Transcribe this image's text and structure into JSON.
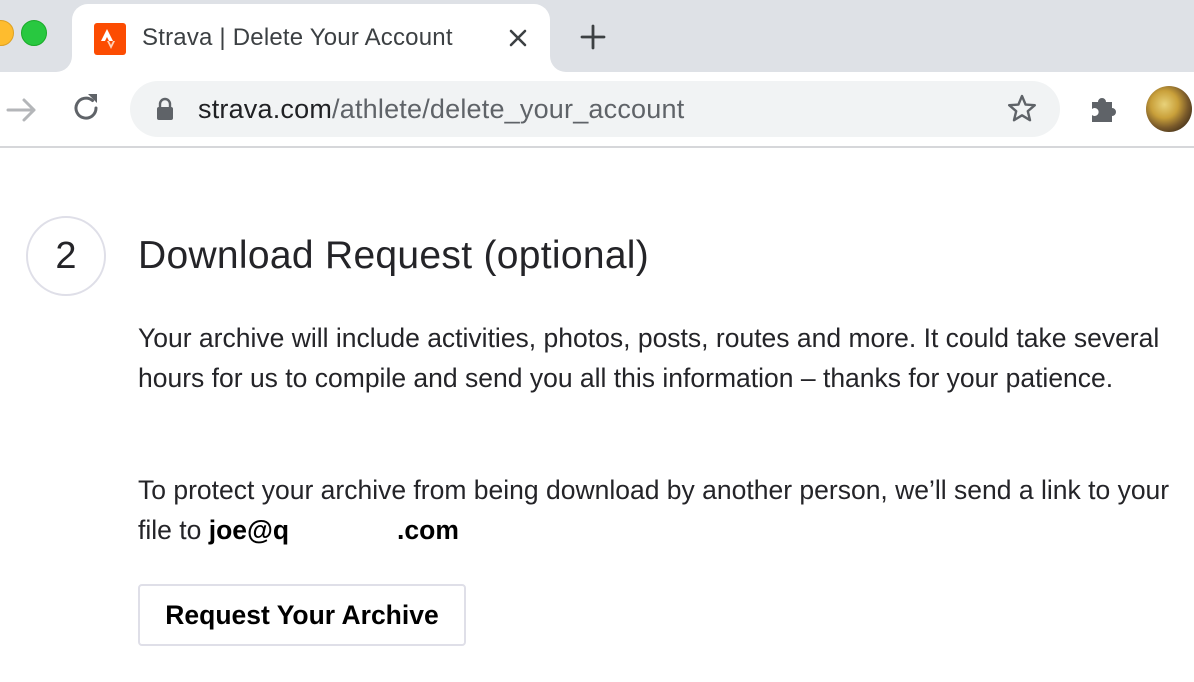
{
  "browser": {
    "tab": {
      "title": "Strava | Delete Your Account",
      "favicon": "strava-logo-icon",
      "favicon_color": "#fc4c02"
    },
    "new_tab_icon": "plus-icon",
    "toolbar": {
      "forward_icon": "arrow-right-icon",
      "reload_icon": "reload-icon",
      "url_host": "strava.com",
      "url_path": "/athlete/delete_your_account",
      "lock_icon": "lock-icon",
      "bookmark_icon": "star-icon",
      "extensions_icon": "puzzle-icon"
    }
  },
  "page": {
    "step_number": "2",
    "title": "Download Request (optional)",
    "paragraph1": "Your archive will include activities, photos, posts, routes and more. It could take several hours for us to compile and send you all this information – thanks for your patience.",
    "paragraph2_prefix": "To protect your archive from being download by another person, we’ll send a link to your file to ",
    "email_start": "joe@q",
    "email_end": ".com",
    "button_label": "Request Your Archive"
  }
}
